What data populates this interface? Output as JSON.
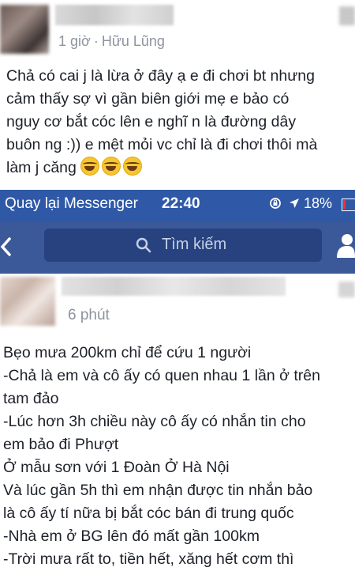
{
  "post_top": {
    "time": "1 giờ",
    "separator": "·",
    "location": "Hữu Lũng",
    "lines": [
      "Chả có cai j là lừa ở đây ạ e đi chơi bt nhưng",
      "cảm thấy sợ vì gần biên giới mẹ e bảo có",
      "nguy cơ bắt cóc lên e nghĩ n là đường dây",
      "buôn ng :)) e mệt mỏi vc chỉ là đi chơi thôi mà",
      "làm j căng"
    ],
    "emoji": "face-with-tears-of-joy-icon"
  },
  "status_bar": {
    "back_label": "Quay lại Messenger",
    "time": "22:40",
    "battery": "18%",
    "bg_color": "#2f59a7"
  },
  "nav": {
    "search_placeholder": "Tìm kiếm",
    "bg_color": "#3b5998"
  },
  "post_bottom": {
    "time": "6 phút",
    "lines": [
      "Bẹo mưa 200km chỉ để cứu 1 người",
      "-Chả là em và cô ấy có quen nhau 1 lần ở trên",
      "tam đảo",
      "-Lúc hơn 3h chiều này cô ấy có nhắn tin cho",
      "em bảo đi Phượt",
      "Ở mẫu sơn với 1 Đoàn Ở Hà Nội",
      "Và lúc gần 5h thì em nhận được tin nhắn bảo",
      "là cô ấy tí nữa bị bắt cóc bán đi trung quốc",
      "-Nhà em ở BG lên đó mất gần 100km",
      "-Trời mưa rất to, tiền hết, xăng hết cơm thì"
    ]
  }
}
